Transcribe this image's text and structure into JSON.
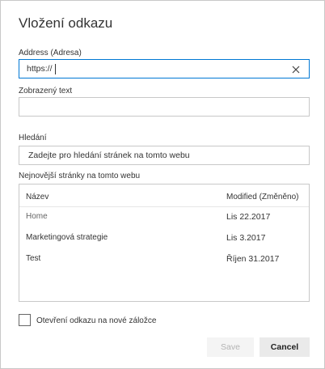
{
  "dialog": {
    "title": "Vložení odkazu"
  },
  "address": {
    "label": "Address (Adresa)",
    "value": "https://"
  },
  "display_text": {
    "label": "Zobrazený text",
    "value": ""
  },
  "search": {
    "label": "Hledání",
    "placeholder": "Zadejte pro hledání stránek na tomto webu"
  },
  "recent": {
    "label": "Nejnovější stránky na tomto webu",
    "columns": {
      "name": "Název",
      "modified": "Modified (Změněno)"
    },
    "rows": [
      {
        "name": "Home",
        "modified": "Lis 22.2017"
      },
      {
        "name": "Marketingová strategie",
        "modified": "Lis 3.2017"
      },
      {
        "name": "Test",
        "modified": "Říjen 31.2017"
      }
    ]
  },
  "new_tab": {
    "label": "Otevření odkazu na nové záložce",
    "checked": false
  },
  "buttons": {
    "save": "Save",
    "cancel": "Cancel"
  },
  "icons": {
    "clear": "close-icon"
  },
  "colors": {
    "focus_border": "#0078d4",
    "disabled_text": "#b3b3b3"
  }
}
